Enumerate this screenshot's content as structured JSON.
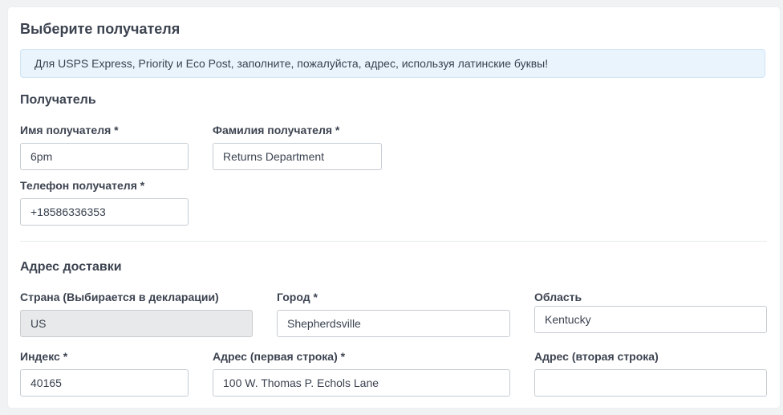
{
  "form": {
    "title": "Выберите получателя",
    "notice": "Для USPS Express, Priority и Eco Post, заполните, пожалуйста, адрес, используя латинские буквы!",
    "recipient": {
      "section_title": "Получатель",
      "first_name_label": "Имя получателя *",
      "first_name_value": "6pm",
      "last_name_label": "Фамилия получателя *",
      "last_name_value": "Returns Department",
      "phone_label": "Телефон получателя *",
      "phone_value": "+18586336353"
    },
    "address": {
      "section_title": "Адрес доставки",
      "country_label": "Страна (Выбирается в декларации)",
      "country_value": "US",
      "city_label": "Город *",
      "city_value": "Shepherdsville",
      "region_label": "Область",
      "region_value": "Kentucky",
      "zip_label": "Индекс *",
      "zip_value": "40165",
      "line1_label": "Адрес (первая строка) *",
      "line1_value": "100 W. Thomas P. Echols Lane",
      "line2_label": "Адрес (вторая строка)",
      "line2_value": ""
    }
  },
  "colors": {
    "notice_background": "#e9f4fd",
    "disabled_background": "#e8e9ea"
  }
}
